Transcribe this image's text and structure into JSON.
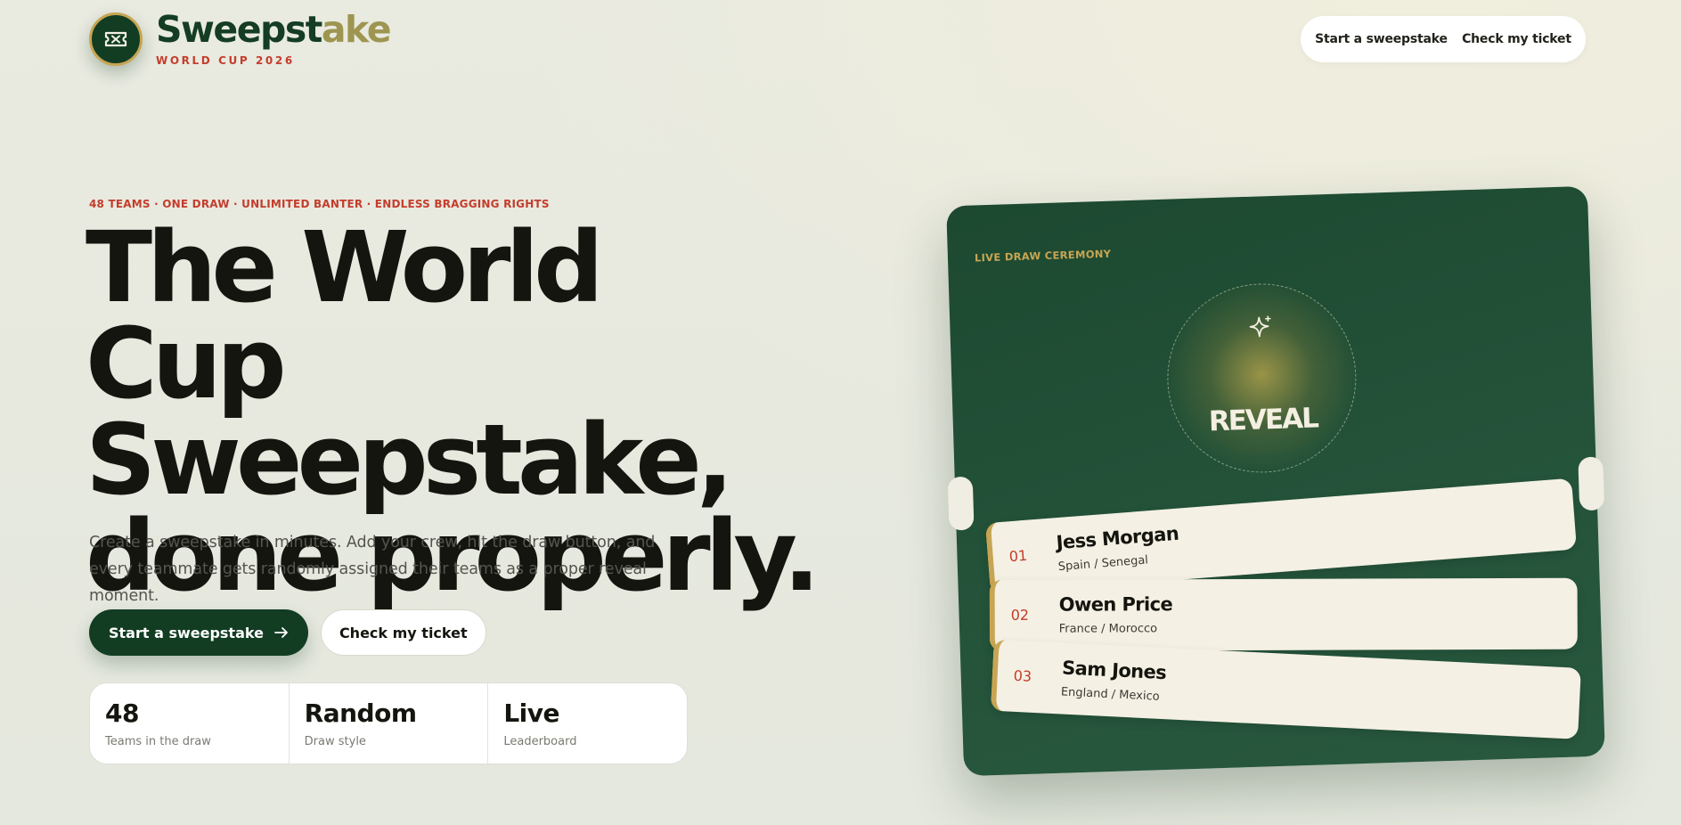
{
  "brand": {
    "title_main": "Sweepst",
    "title_tail": "ake",
    "subtitle": "WORLD CUP 2026",
    "logo_icon": "ticket-icon"
  },
  "nav": {
    "start": "Start a sweepstake",
    "check": "Check my ticket"
  },
  "hero": {
    "eyebrow": "48 TEAMS · ONE DRAW · UNLIMITED BANTER · ENDLESS BRAGGING RIGHTS",
    "headline_lines": [
      "The World Cup",
      "Sweepstake,",
      "done properly."
    ],
    "lede": "Create a sweepstake in minutes. Add your crew, hit the draw button, and every teammate gets randomly assigned their teams as a proper reveal moment.",
    "primary_cta": "Start a sweepstake",
    "primary_cta_icon": "arrow-right-icon",
    "secondary_cta": "Check my ticket"
  },
  "stats": [
    {
      "value": "48",
      "label": "Teams in the draw"
    },
    {
      "value": "Random",
      "label": "Draw style"
    },
    {
      "value": "Live",
      "label": "Leaderboard"
    }
  ],
  "draw": {
    "label": "LIVE DRAW CEREMONY",
    "reveal": "REVEAL",
    "reveal_icon": "sparkle-icon",
    "tickets": [
      {
        "num": "01",
        "name": "Jess Morgan",
        "teams": "Spain / Senegal"
      },
      {
        "num": "02",
        "name": "Owen Price",
        "teams": "France / Morocco"
      },
      {
        "num": "03",
        "name": "Sam Jones",
        "teams": "England / Mexico"
      }
    ]
  },
  "colors": {
    "brand_green": "#123d23",
    "gold": "#c8a553",
    "accent_red": "#c43d2c",
    "card_green": "#24533a",
    "ticket_cream": "#f4f0e4"
  }
}
